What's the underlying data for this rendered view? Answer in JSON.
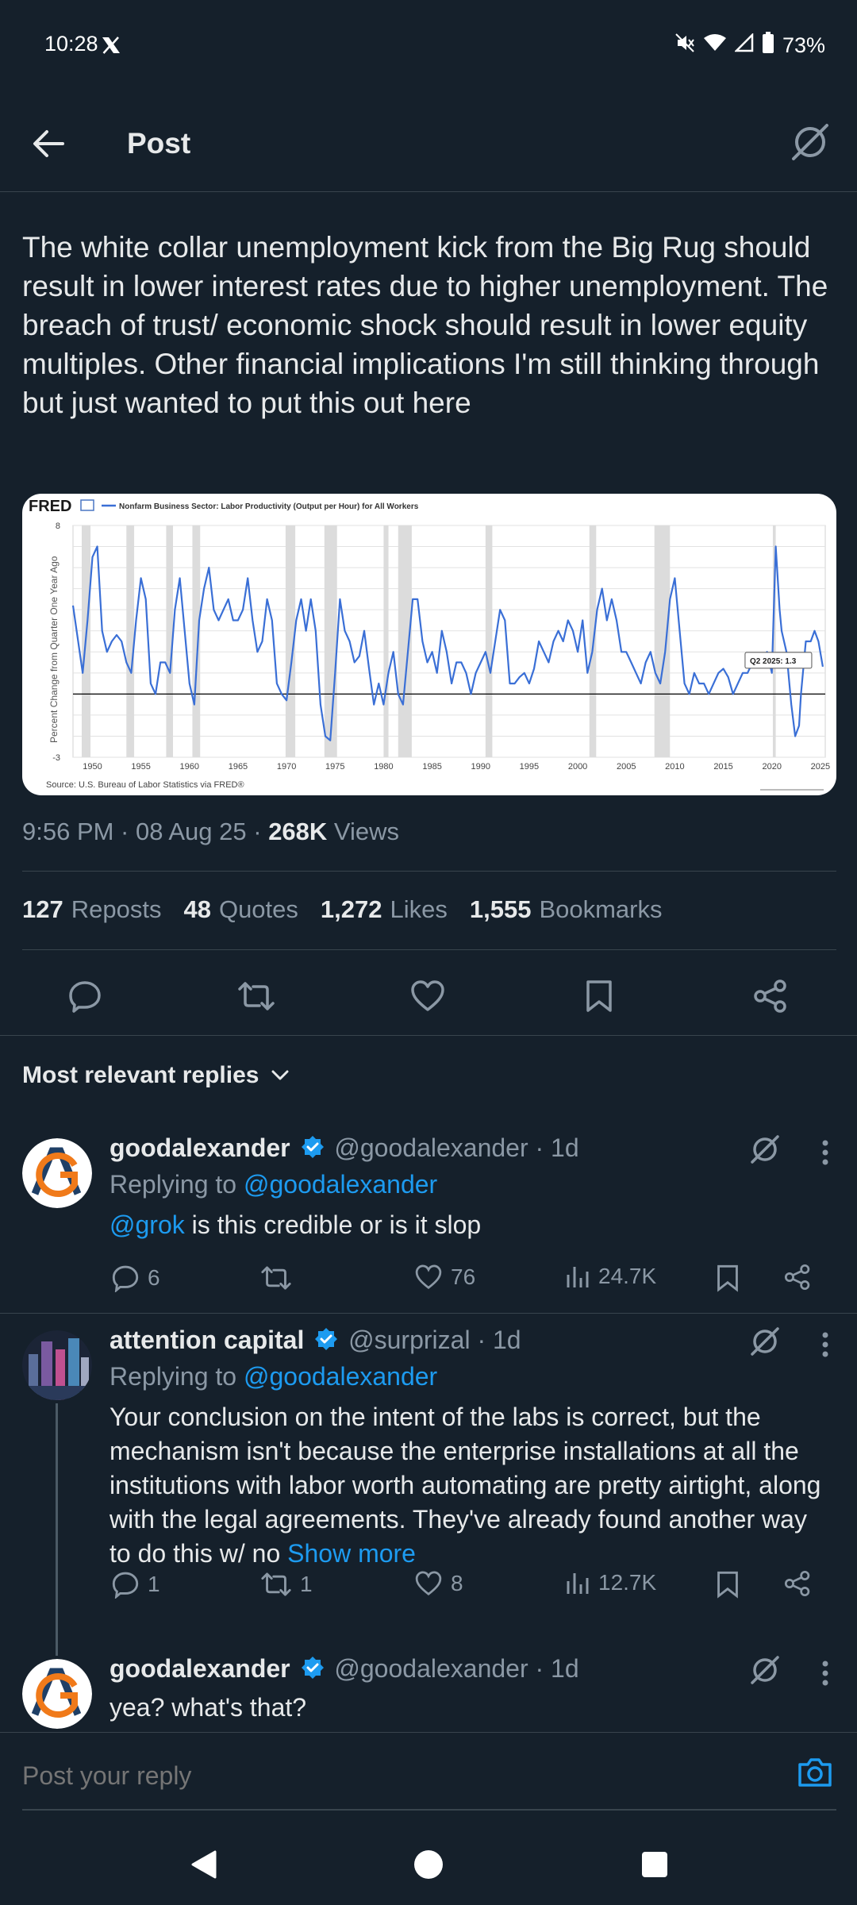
{
  "status_bar": {
    "time": "10:28",
    "battery": "73%"
  },
  "header": {
    "title": "Post"
  },
  "post": {
    "text": "The white collar unemployment kick from the Big Rug should result in lower interest rates due to higher unemployment. The breach of trust/ economic shock should result in lower equity multiples. Other financial implications I'm still thinking through but just wanted to put this out here",
    "time": "9:56 PM · 08 Aug 25 · ",
    "views_count": "268K",
    "views_label": " Views",
    "stats": [
      {
        "num": "127",
        "label": "Reposts"
      },
      {
        "num": "48",
        "label": "Quotes"
      },
      {
        "num": "1,272",
        "label": "Likes"
      },
      {
        "num": "1,555",
        "label": "Bookmarks"
      }
    ]
  },
  "chart_data": {
    "type": "line",
    "logo": "FRED",
    "title": "Nonfarm Business Sector: Labor Productivity (Output per Hour) for All Workers",
    "ylabel": "Percent Change from Quarter One Year Ago",
    "source": "Source: U.S. Bureau of Labor Statistics via FRED®",
    "annotation": "Q2 2025: 1.3",
    "xlim": [
      1948,
      2025.5
    ],
    "ylim": [
      -3,
      8
    ],
    "x_ticks": [
      "1950",
      "1955",
      "1960",
      "1965",
      "1970",
      "1975",
      "1980",
      "1985",
      "1990",
      "1995",
      "2000",
      "2005",
      "2010",
      "2015",
      "2020",
      "2025"
    ],
    "y_ticks": [
      "8",
      "-3"
    ],
    "recessions": [
      [
        1948.9,
        1949.8
      ],
      [
        1953.5,
        1954.3
      ],
      [
        1957.6,
        1958.3
      ],
      [
        1960.3,
        1961.1
      ],
      [
        1969.9,
        1970.9
      ],
      [
        1973.9,
        1975.2
      ],
      [
        1980.0,
        1980.5
      ],
      [
        1981.5,
        1982.9
      ],
      [
        1990.5,
        1991.2
      ],
      [
        2001.2,
        2001.9
      ],
      [
        2007.9,
        2009.5
      ],
      [
        2020.1,
        2020.4
      ]
    ],
    "series": [
      {
        "values": [
          [
            1948,
            4.2
          ],
          [
            1949,
            1.0
          ],
          [
            1949.5,
            3.5
          ],
          [
            1950,
            6.5
          ],
          [
            1950.5,
            7.0
          ],
          [
            1951,
            3.0
          ],
          [
            1951.5,
            2.0
          ],
          [
            1952,
            2.5
          ],
          [
            1952.5,
            2.8
          ],
          [
            1953,
            2.5
          ],
          [
            1953.5,
            1.5
          ],
          [
            1954,
            1.0
          ],
          [
            1954.5,
            3.5
          ],
          [
            1955,
            5.5
          ],
          [
            1955.5,
            4.5
          ],
          [
            1956,
            0.5
          ],
          [
            1956.5,
            0.0
          ],
          [
            1957,
            1.5
          ],
          [
            1957.5,
            1.5
          ],
          [
            1958,
            1.0
          ],
          [
            1958.5,
            4.0
          ],
          [
            1959,
            5.5
          ],
          [
            1959.5,
            3.0
          ],
          [
            1960,
            0.5
          ],
          [
            1960.5,
            -0.5
          ],
          [
            1961,
            3.5
          ],
          [
            1961.5,
            5.0
          ],
          [
            1962,
            6.0
          ],
          [
            1962.5,
            4.0
          ],
          [
            1963,
            3.5
          ],
          [
            1963.5,
            4.0
          ],
          [
            1964,
            4.5
          ],
          [
            1964.5,
            3.5
          ],
          [
            1965,
            3.5
          ],
          [
            1965.5,
            4.0
          ],
          [
            1966,
            5.5
          ],
          [
            1966.5,
            3.5
          ],
          [
            1967,
            2.0
          ],
          [
            1967.5,
            2.5
          ],
          [
            1968,
            4.5
          ],
          [
            1968.5,
            3.5
          ],
          [
            1969,
            0.5
          ],
          [
            1969.5,
            0.0
          ],
          [
            1970,
            -0.3
          ],
          [
            1970.5,
            1.5
          ],
          [
            1971,
            3.5
          ],
          [
            1971.5,
            4.5
          ],
          [
            1972,
            3.0
          ],
          [
            1972.5,
            4.5
          ],
          [
            1973,
            3.0
          ],
          [
            1973.5,
            -0.5
          ],
          [
            1974,
            -2.0
          ],
          [
            1974.5,
            -2.2
          ],
          [
            1975,
            1.0
          ],
          [
            1975.5,
            4.5
          ],
          [
            1976,
            3.0
          ],
          [
            1976.5,
            2.5
          ],
          [
            1977,
            1.5
          ],
          [
            1977.5,
            1.8
          ],
          [
            1978,
            3.0
          ],
          [
            1978.5,
            1.2
          ],
          [
            1979,
            -0.5
          ],
          [
            1979.5,
            0.5
          ],
          [
            1980,
            -0.5
          ],
          [
            1980.5,
            1.0
          ],
          [
            1981,
            2.0
          ],
          [
            1981.5,
            0.0
          ],
          [
            1982,
            -0.5
          ],
          [
            1982.5,
            2.0
          ],
          [
            1983,
            4.5
          ],
          [
            1983.5,
            4.5
          ],
          [
            1984,
            2.5
          ],
          [
            1984.5,
            1.5
          ],
          [
            1985,
            2.0
          ],
          [
            1985.5,
            1.0
          ],
          [
            1986,
            3.0
          ],
          [
            1986.5,
            2.0
          ],
          [
            1987,
            0.5
          ],
          [
            1987.5,
            1.5
          ],
          [
            1988,
            1.5
          ],
          [
            1988.5,
            1.0
          ],
          [
            1989,
            0.0
          ],
          [
            1989.5,
            1.0
          ],
          [
            1990,
            1.5
          ],
          [
            1990.5,
            2.0
          ],
          [
            1991,
            1.0
          ],
          [
            1991.5,
            2.5
          ],
          [
            1992,
            4.0
          ],
          [
            1992.5,
            3.5
          ],
          [
            1993,
            0.5
          ],
          [
            1993.5,
            0.5
          ],
          [
            1994,
            0.8
          ],
          [
            1994.5,
            1.0
          ],
          [
            1995,
            0.5
          ],
          [
            1995.5,
            1.2
          ],
          [
            1996,
            2.5
          ],
          [
            1996.5,
            2.0
          ],
          [
            1997,
            1.5
          ],
          [
            1997.5,
            2.5
          ],
          [
            1998,
            3.0
          ],
          [
            1998.5,
            2.5
          ],
          [
            1999,
            3.5
          ],
          [
            1999.5,
            3.0
          ],
          [
            2000,
            2.0
          ],
          [
            2000.5,
            3.5
          ],
          [
            2001,
            1.0
          ],
          [
            2001.5,
            2.0
          ],
          [
            2002,
            4.0
          ],
          [
            2002.5,
            5.0
          ],
          [
            2003,
            3.5
          ],
          [
            2003.5,
            4.5
          ],
          [
            2004,
            3.5
          ],
          [
            2004.5,
            2.0
          ],
          [
            2005,
            2.0
          ],
          [
            2005.5,
            1.5
          ],
          [
            2006,
            1.0
          ],
          [
            2006.5,
            0.5
          ],
          [
            2007,
            1.5
          ],
          [
            2007.5,
            2.0
          ],
          [
            2008,
            1.0
          ],
          [
            2008.5,
            0.5
          ],
          [
            2009,
            2.0
          ],
          [
            2009.5,
            4.5
          ],
          [
            2010,
            5.5
          ],
          [
            2010.5,
            3.0
          ],
          [
            2011,
            0.5
          ],
          [
            2011.5,
            0.0
          ],
          [
            2012,
            1.0
          ],
          [
            2012.5,
            0.5
          ],
          [
            2013,
            0.5
          ],
          [
            2013.5,
            0.0
          ],
          [
            2014,
            0.5
          ],
          [
            2014.5,
            1.0
          ],
          [
            2015,
            1.2
          ],
          [
            2015.5,
            0.8
          ],
          [
            2016,
            0.0
          ],
          [
            2016.5,
            0.5
          ],
          [
            2017,
            1.0
          ],
          [
            2017.5,
            1.0
          ],
          [
            2018,
            1.5
          ],
          [
            2018.5,
            1.8
          ],
          [
            2019,
            1.5
          ],
          [
            2019.5,
            2.0
          ],
          [
            2020,
            1.0
          ],
          [
            2020.4,
            7.0
          ],
          [
            2020.8,
            4.0
          ],
          [
            2021,
            3.0
          ],
          [
            2021.5,
            2.0
          ],
          [
            2022,
            -0.5
          ],
          [
            2022.4,
            -2.0
          ],
          [
            2022.8,
            -1.5
          ],
          [
            2023,
            0.0
          ],
          [
            2023.5,
            2.5
          ],
          [
            2024,
            2.5
          ],
          [
            2024.4,
            3.0
          ],
          [
            2024.8,
            2.5
          ],
          [
            2025.25,
            1.3
          ]
        ]
      }
    ]
  },
  "replies_section": {
    "title": "Most relevant replies"
  },
  "replies": [
    {
      "name": "goodalexander",
      "handle": "@goodalexander · 1d",
      "replying_prefix": "Replying to ",
      "replying_to": "@goodalexander",
      "mention": "@grok",
      "body": " is this credible or is it slop",
      "comments": "6",
      "reposts": "",
      "likes": "76",
      "views": "24.7K"
    },
    {
      "name": "attention capital",
      "handle": "@surprizal · 1d",
      "replying_prefix": "Replying to ",
      "replying_to": "@goodalexander",
      "body": "Your conclusion on the intent of the labs is correct, but the mechanism isn't because the enterprise installations at all the institutions with labor worth automating are pretty airtight, along with the legal agreements. They've already found another way to do this w/ no ",
      "show_more": "Show more",
      "comments": "1",
      "reposts": "1",
      "likes": "8",
      "views": "12.7K"
    },
    {
      "name": "goodalexander",
      "handle": "@goodalexander · 1d",
      "body": "yea? what's that?"
    }
  ],
  "reply_bar": {
    "placeholder": "Post your reply"
  },
  "colors": {
    "background": "#15202b",
    "accent": "#1d9bf0",
    "secondary_text": "#8b98a5",
    "chart_line": "#3a6fd6"
  }
}
